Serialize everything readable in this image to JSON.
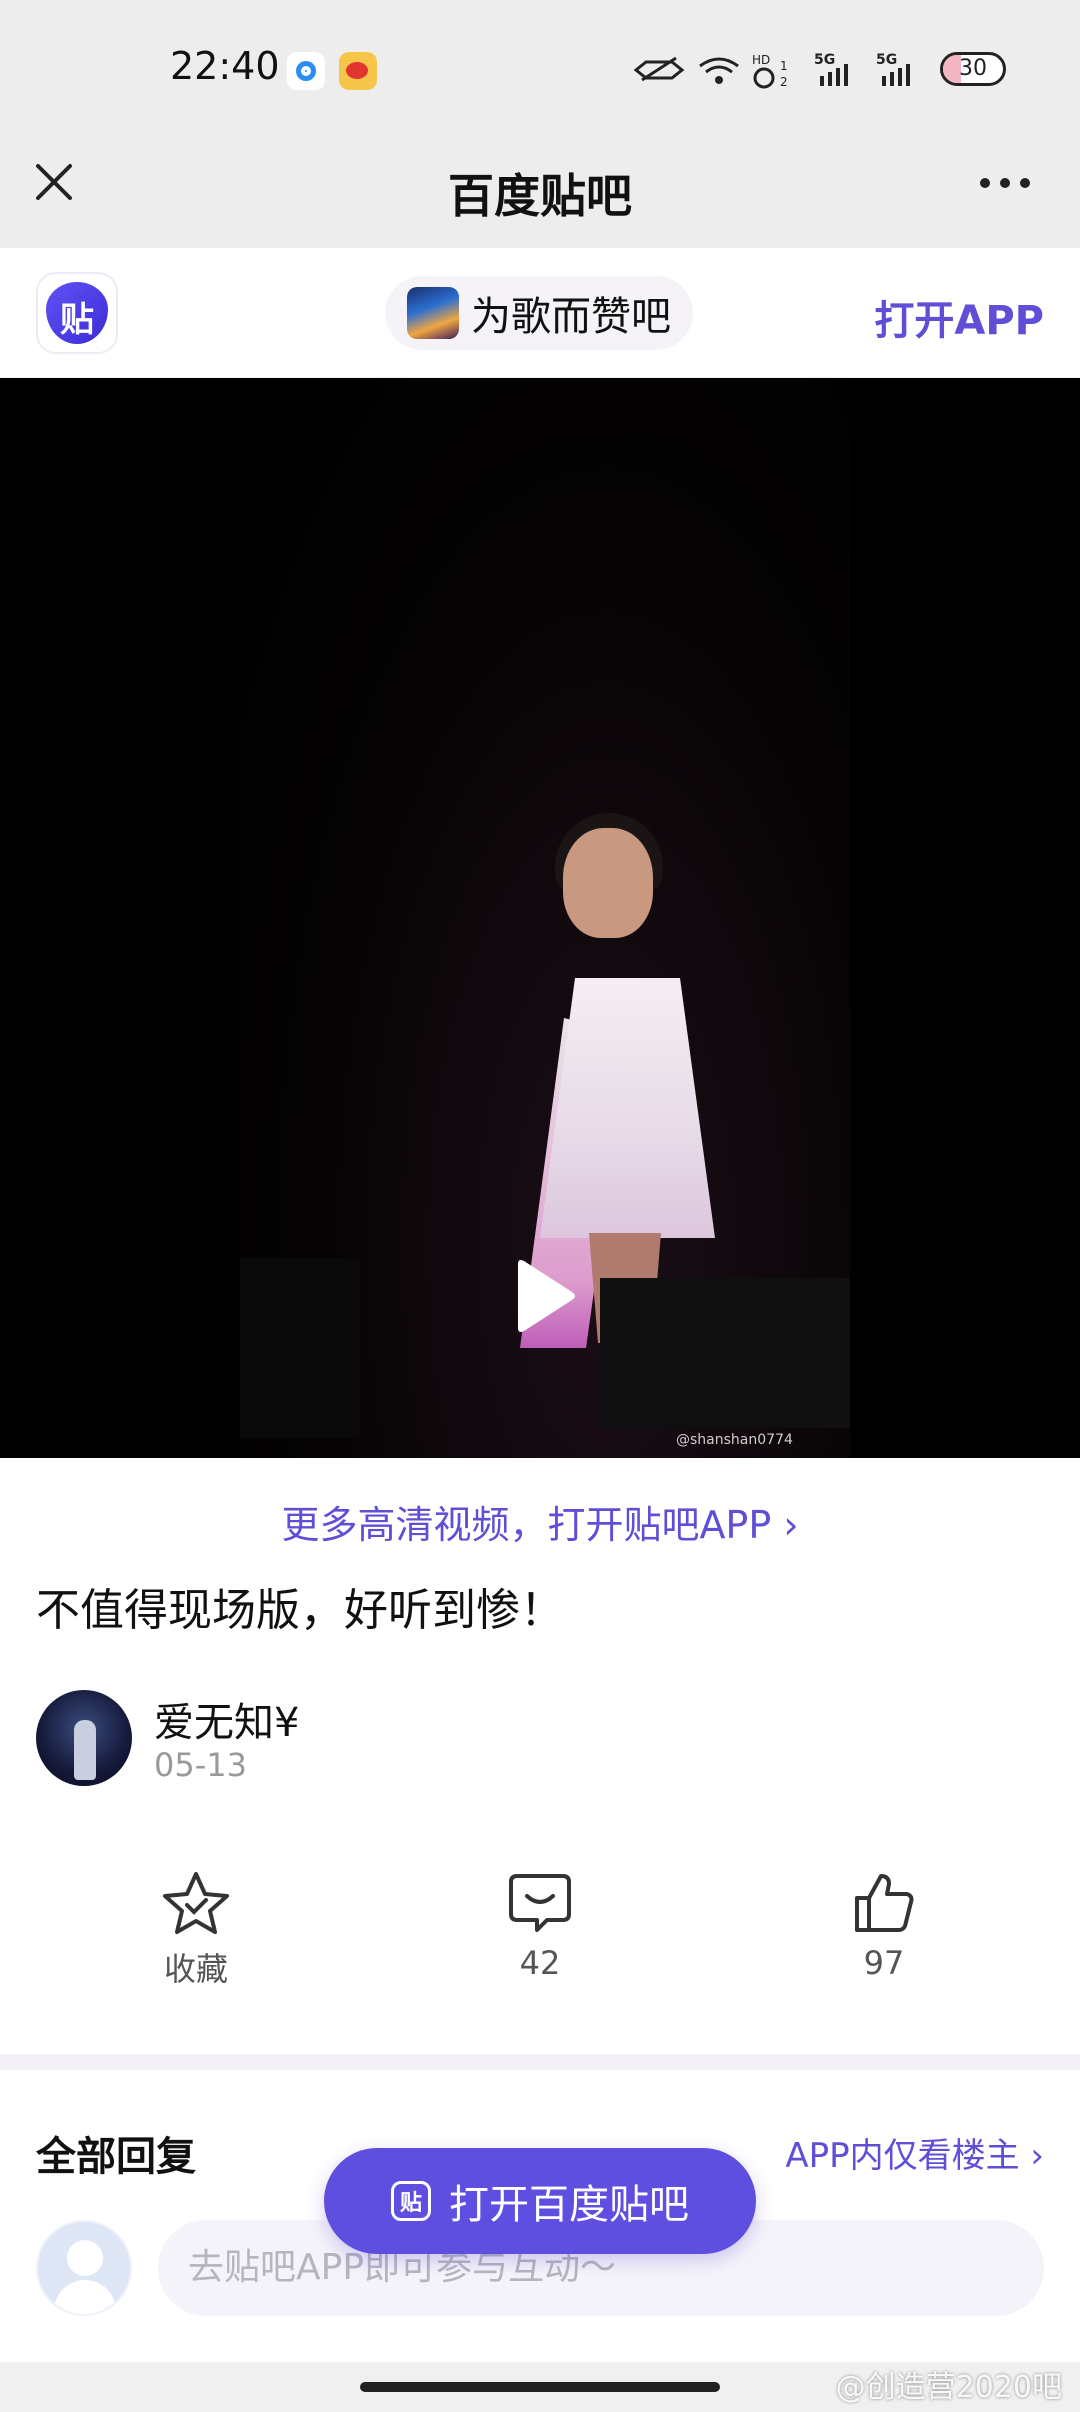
{
  "status_bar": {
    "time": "22:40",
    "battery": "30",
    "battery_level": 0.3
  },
  "title_bar": {
    "title": "百度贴吧"
  },
  "app_banner": {
    "logo_char": "贴",
    "forum_name": "为歌而赞吧",
    "open_app": "打开APP"
  },
  "video": {
    "watermark": "@shanshan0774"
  },
  "hd_link": "更多高清视频，打开贴吧APP ›",
  "post": {
    "title": "不值得现场版，好听到惨！",
    "author": "爱无知¥",
    "date": "05-13"
  },
  "actions": {
    "favorite_label": "收藏",
    "comment_count": "42",
    "like_count": "97"
  },
  "replies": {
    "title": "全部回复",
    "op_only_link": "APP内仅看楼主 ›",
    "input_placeholder": "去贴吧APP即可参与互动～"
  },
  "float_button": {
    "logo_char": "贴",
    "label": "打开百度贴吧"
  },
  "page_watermark": "@创造营2020吧",
  "colors": {
    "accent": "#5f4fd6",
    "status_bg": "#ededed"
  }
}
